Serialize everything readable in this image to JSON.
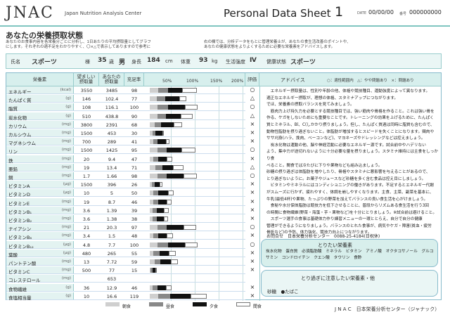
{
  "header": {
    "logo": "JNAC",
    "logo_sub": "Japan Nutrition Analysis Center",
    "title": "Personal Data Sheet",
    "title_num": "1",
    "date_label": "DATE",
    "date_value": "00/00/00",
    "num_label": "番号",
    "num_value": "000000000"
  },
  "section_title": "あなたの栄養摂取状態",
  "note_left": [
    "あなたのお食事内容を各栄養分ごとに分析し、1日あたりの平均摂取量としてグラフ",
    "にします。それぞれの適不足をわかりやすく、〇×△で表示してありますので参考に"
  ],
  "note_right": [
    "右の欄では、分析データをもとに管理栄養士が、あなたの食生活改善のポイントや、",
    "あなたの健康状態をよりよくするために必要な栄養素をアドバイスします。"
  ],
  "profile": {
    "name_label": "氏名",
    "name": "スポーツ",
    "honorific": "様",
    "age": "35",
    "age_unit": "歳",
    "sex": "男",
    "height_label": "身長",
    "height": "184",
    "height_unit": "cm",
    "weight_label": "体重",
    "weight": "93",
    "weight_unit": "kg",
    "activity_label": "生活強度",
    "activity": "Ⅳ",
    "health_label": "健康状態",
    "health": "スポーツ"
  },
  "table_headers": {
    "nutrient": "栄養素",
    "recommended": [
      "望ましい",
      "摂取量"
    ],
    "actual": [
      "あなたの",
      "摂取量"
    ],
    "ratio": "充足率",
    "eval": "評価",
    "advice": "アドバイス",
    "scale": [
      "50%",
      "100%",
      "150%",
      "200%"
    ]
  },
  "eval_legend": "○：適性範囲内　△：やや問題あり　×：問題あり",
  "nutrients": [
    {
      "name": "エネルギー",
      "unit": "(kcal)",
      "rec": "3550",
      "act": "3485",
      "pct": "98",
      "eval": "○",
      "b": 18,
      "l": 20,
      "d": 30,
      "s": 30
    },
    {
      "name": "たんぱく質",
      "unit": "(g)",
      "rec": "146",
      "act": "102.4",
      "pct": "77",
      "eval": "△",
      "b": 14,
      "l": 18,
      "d": 30,
      "s": 15
    },
    {
      "name": "脂質",
      "unit": "(g)",
      "rec": "108",
      "act": "116.1",
      "pct": "100",
      "eval": "○",
      "b": 16,
      "l": 22,
      "d": 36,
      "s": 26
    },
    {
      "name": "炭水化物",
      "unit": "(g)",
      "rec": "510",
      "act": "438.8",
      "pct": "90",
      "eval": "△",
      "b": 16,
      "l": 18,
      "d": 30,
      "s": 26
    },
    {
      "name": "カリウム",
      "unit": "(mg)",
      "rec": "3800",
      "act": "2391",
      "pct": "68",
      "eval": "×",
      "b": 10,
      "l": 14,
      "d": 26,
      "s": 18
    },
    {
      "name": "カルシウム",
      "unit": "(mg)",
      "rec": "1500",
      "act": "453",
      "pct": "30",
      "eval": "×",
      "b": 6,
      "l": 6,
      "d": 14,
      "s": 4
    },
    {
      "name": "マグネシウム",
      "unit": "(mg)",
      "rec": "700",
      "act": "289",
      "pct": "41",
      "eval": "×",
      "b": 8,
      "l": 8,
      "d": 18,
      "s": 7
    },
    {
      "name": "リン",
      "unit": "(mg)",
      "rec": "1500",
      "act": "1425",
      "pct": "95",
      "eval": "○",
      "b": 16,
      "l": 20,
      "d": 30,
      "s": 29
    },
    {
      "name": "鉄",
      "unit": "(mg)",
      "rec": "20",
      "act": "9.4",
      "pct": "47",
      "eval": "×",
      "b": 8,
      "l": 10,
      "d": 18,
      "s": 11
    },
    {
      "name": "亜鉛",
      "unit": "(mg)",
      "rec": "19",
      "act": "13.4",
      "pct": "71",
      "eval": "△",
      "b": 12,
      "l": 14,
      "d": 22,
      "s": 23
    },
    {
      "name": "銅",
      "unit": "(mg)",
      "rec": "1.7",
      "act": "1.66",
      "pct": "98",
      "eval": "○",
      "b": 16,
      "l": 20,
      "d": 34,
      "s": 28
    },
    {
      "name": "ビタミンA",
      "unit": "(μg)",
      "rec": "1500",
      "act": "396",
      "pct": "26",
      "eval": "×",
      "b": 4,
      "l": 6,
      "d": 10,
      "s": 6
    },
    {
      "name": "ビタミンD",
      "unit": "(μg)",
      "rec": "10",
      "act": "5",
      "pct": "50",
      "eval": "×",
      "b": 8,
      "l": 10,
      "d": 20,
      "s": 12
    },
    {
      "name": "ビタミンE",
      "unit": "(mg)",
      "rec": "19",
      "act": "8.7",
      "pct": "46",
      "eval": "×",
      "b": 8,
      "l": 10,
      "d": 18,
      "s": 10
    },
    {
      "name": "ビタミンB₁",
      "unit": "(mg)",
      "rec": "3.6",
      "act": "1.39",
      "pct": "39",
      "eval": "×",
      "b": 6,
      "l": 8,
      "d": 16,
      "s": 9
    },
    {
      "name": "ビタミンB₂",
      "unit": "(mg)",
      "rec": "3.6",
      "act": "1.38",
      "pct": "38",
      "eval": "×",
      "b": 6,
      "l": 8,
      "d": 16,
      "s": 8
    },
    {
      "name": "ナイアシン",
      "unit": "(mg)",
      "rec": "21",
      "act": "20.3",
      "pct": "97",
      "eval": "○",
      "b": 16,
      "l": 20,
      "d": 34,
      "s": 27
    },
    {
      "name": "ビタミンB₆",
      "unit": "(mg)",
      "rec": "3.4",
      "act": "1.5",
      "pct": "48",
      "eval": "×",
      "b": 8,
      "l": 10,
      "d": 18,
      "s": 12
    },
    {
      "name": "ビタミンB₁₂",
      "unit": "(μg)",
      "rec": "4.8",
      "act": "7.7",
      "pct": "100",
      "eval": "○",
      "b": 16,
      "l": 22,
      "d": 36,
      "s": 26
    },
    {
      "name": "葉酸",
      "unit": "(μg)",
      "rec": "480",
      "act": "265",
      "pct": "55",
      "eval": "×",
      "b": 8,
      "l": 12,
      "d": 20,
      "s": 15
    },
    {
      "name": "パントテン酸",
      "unit": "(mg)",
      "rec": "13",
      "act": "7.72",
      "pct": "59",
      "eval": "×",
      "b": 10,
      "l": 12,
      "d": 22,
      "s": 15
    },
    {
      "name": "ビタミンC",
      "unit": "(mg)",
      "rec": "500",
      "act": "77",
      "pct": "15",
      "eval": "×",
      "b": 2,
      "l": 4,
      "d": 6,
      "s": 3
    },
    {
      "name": "コレステロール",
      "unit": "(mg)",
      "rec": "",
      "act": "653",
      "pct": "",
      "eval": "",
      "b": 0,
      "l": 0,
      "d": 0,
      "s": 0
    },
    {
      "name": "食物繊維",
      "unit": "(g)",
      "rec": "36",
      "act": "12.9",
      "pct": "46",
      "eval": "×",
      "b": 6,
      "l": 10,
      "d": 18,
      "s": 12
    },
    {
      "name": "食塩相当量",
      "unit": "(g)",
      "rec": "10",
      "act": "16.6",
      "pct": "119",
      "eval": "×",
      "b": 18,
      "l": 24,
      "d": 44,
      "s": 33
    }
  ],
  "advice_lines": [
    "　エネルギー摂取量は、性別や年齢の他、体格や競技種目、運動強度によって異なります。",
    "適正なエネルギー摂取が、理想の体格、スタミナアップにつながります。",
    "でほ、栄養素の摂取バランスを見てみましょう。",
    "　筋肉力上げ持久力を必要とする競技種目では、強い筋肉や骨格を作ること。これは強い骨を",
    "作る、ケガをしないためにも重要なことです。トレーニングの効果を上げるために、たんぱく",
    "質とミネラル、Bl、C(しかかり摂りましょう。但し、たんぱく質過は同時に脂質も含むので、",
    "動物性脂肪を摂り過ぎないこと。体脂肪が増加するとスピードを失くことになります。鶏肉や",
    "ササ刈身(ハラ、挽肉、ベーコンなど)、マヨネーズやドレッシングなどは控えましょう。",
    "　炭水化物は運動の他、脳や神経活動に必要なエネルギー源です。試合前中やハデリない",
    "よう、集中力が途切れないように十分必要な量を摂りましょう。スタミナ維持には主食をしっかり食",
    "べること。間食では冷たびに下りや果物なども組み込ましょう。",
    "砂糖の摂り過ぎは体脂肪を増やしたり、骨格やスタミナに悪影響を与えることがあるので、",
    "とり過ぎないように。お菓子やジュースなど砂糖を多く含む食品は控え目にしましょう。",
    "　ビタミンやミネラルにはコンディショニングの働きがあります。不足するとエネルギー代謝",
    "がスムーズに行かず、疲れやすく、体調を崩しやすくなります。主食、主菜、副菜を基本に、",
    "牛乳(最低4杯)や果物、たっぷりの野菜を加えてバランスの良い食生活を心がけましょう。",
    "　食秘や水分保体脂肪は競技力を低下させることに、普段からリズムある食生活を行う3回",
    "の時間に食物繊維(野菜・海藻・芋・果物など)を十分にとりましょう。※試合前は避けること。",
    "　スポーツ選手の食事は基礎体力作り練習メニューの一環ととらえ、自分で自分の健康",
    "管理ができるようになりましょう。バランスのとれた食事が、病気やケガ・障害(貧血・疲労",
    "骨折など)の予防、体力強化、競技力向上につながります。"
  ],
  "contact": "お問合せ　日本栄養分析センター　0088-25-4184(日祝休)",
  "recommended": {
    "title": "とりたい栄養素",
    "foods": "炭水化物　蛋白質　必須脂肪酸　ミネラル　ビタミン　アミノ酸　オクタコサノール　グルコサミン　コンドロイチン　クエン酸　タウリン　食酢"
  },
  "caution": {
    "title": "とり過ぎに注意したい栄養素・他",
    "foods": "砂糖　●たばこ"
  },
  "legend": {
    "breakfast": "朝食",
    "lunch": "昼食",
    "dinner": "夕食",
    "snack": "間食"
  },
  "footer": "J N A C　日本栄養分析センター（ジャナック）",
  "colors": {
    "accent": "#7fc5c0",
    "header_bg": "#d7efed"
  }
}
